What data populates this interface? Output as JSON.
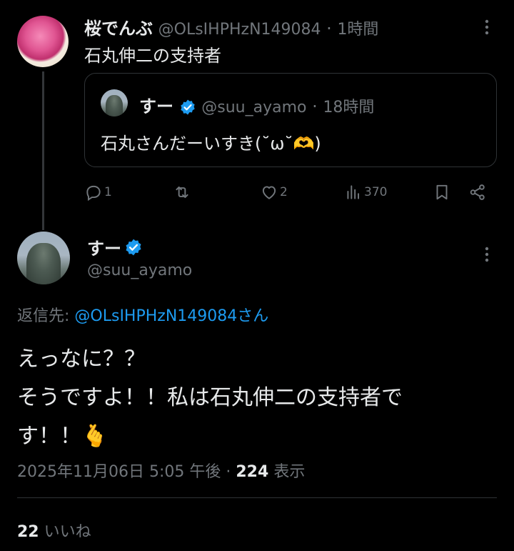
{
  "reply_parent": {
    "author_name": "桜でんぶ",
    "author_handle": "@OLsIHPHzN149084",
    "separator": "·",
    "time": "1時間",
    "text": "石丸伸二の支持者",
    "quoted": {
      "author_name": "すー",
      "author_handle": "@suu_ayamo",
      "separator": "·",
      "time": "18時間",
      "text": "石丸さんだーいすき(˘ω˘🫶)"
    },
    "actions": {
      "replies": "1",
      "retweets": "",
      "likes": "2",
      "views": "370"
    }
  },
  "main_tweet": {
    "author_name": "すー",
    "author_handle": "@suu_ayamo",
    "reply_to_label": "返信先: ",
    "reply_to_handle": "@OLsIHPHzN149084さん",
    "text_line1": "えっなに？？",
    "text_line2": "そうですよ！！私は石丸伸二の支持者で",
    "text_line3": "す！！🫰",
    "timestamp": "2025年11月06日 5:05 午後",
    "separator": "·",
    "views_count": "224",
    "views_label": "表示",
    "likes_count": "22",
    "likes_label": "いいね"
  },
  "colors": {
    "background": "#000000",
    "text": "#e7e9ea",
    "muted": "#71767b",
    "link": "#1d9bf0",
    "verified": "#1d9bf0"
  }
}
